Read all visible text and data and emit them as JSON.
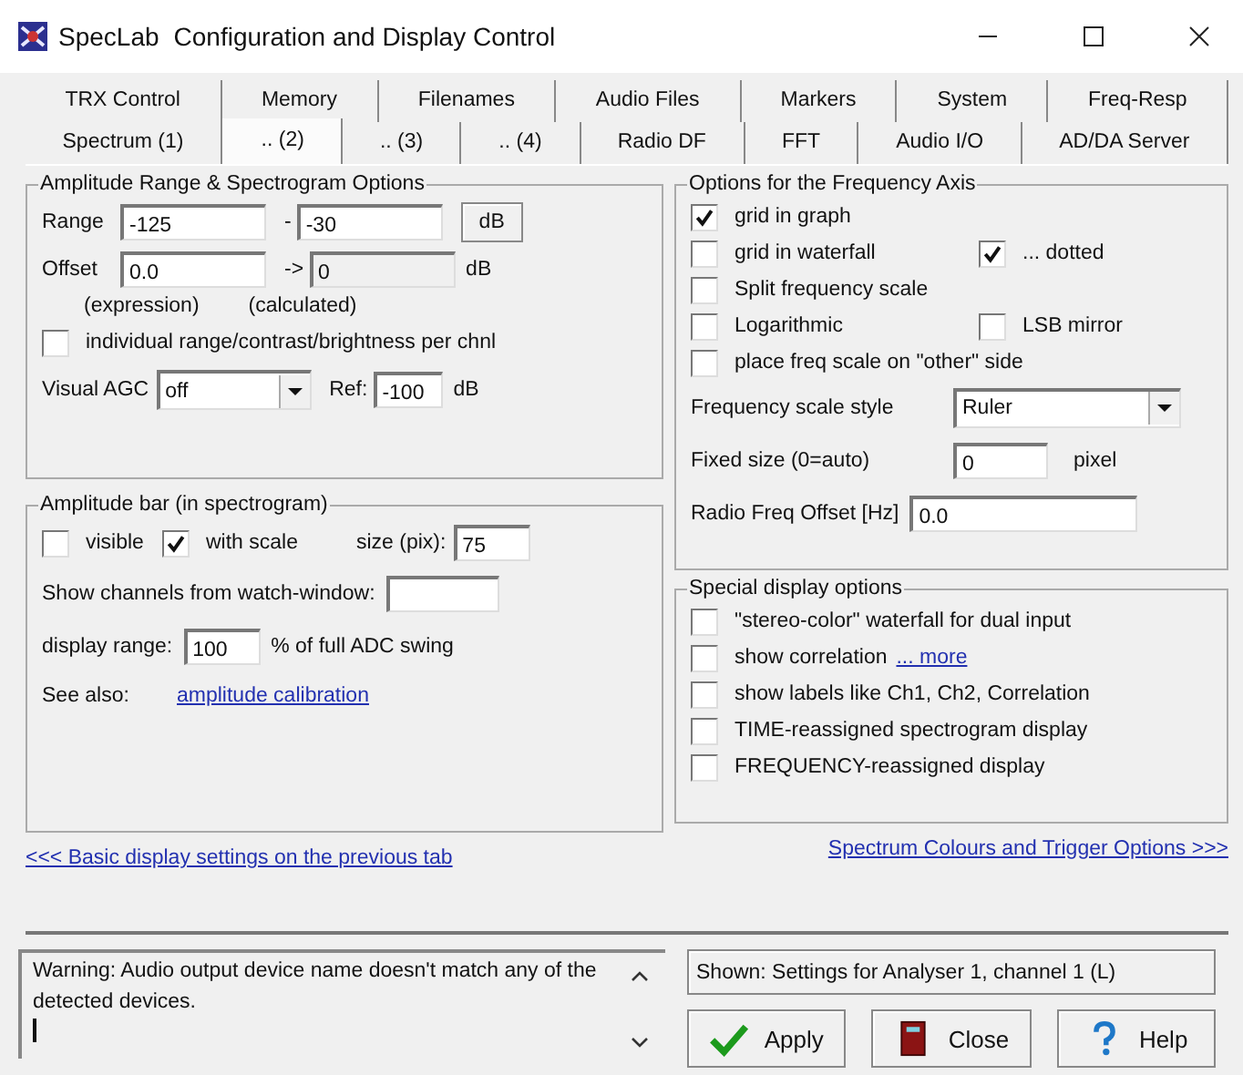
{
  "window": {
    "app_name": "SpecLab",
    "title": "Configuration and Display Control"
  },
  "tabs": [
    [
      {
        "label": "TRX Control",
        "selected": false
      },
      {
        "label": "Memory",
        "selected": false
      },
      {
        "label": "Filenames",
        "selected": false
      },
      {
        "label": "Audio Files",
        "selected": false
      },
      {
        "label": "Markers",
        "selected": false
      },
      {
        "label": "System",
        "selected": false
      },
      {
        "label": "Freq-Resp",
        "selected": false
      }
    ],
    [
      {
        "label": "Spectrum (1)",
        "selected": false
      },
      {
        "label": ".. (2)",
        "selected": true
      },
      {
        "label": ".. (3)",
        "selected": false
      },
      {
        "label": ".. (4)",
        "selected": false
      },
      {
        "label": "Radio DF",
        "selected": false
      },
      {
        "label": "FFT",
        "selected": false
      },
      {
        "label": "Audio I/O",
        "selected": false
      },
      {
        "label": "AD/DA Server",
        "selected": false
      }
    ]
  ],
  "amplitude_range": {
    "title": "Amplitude Range & Spectrogram Options",
    "range_label": "Range",
    "range_from": "-125",
    "range_sep": "-",
    "range_to": "-30",
    "range_unit": "dB",
    "offset_label": "Offset",
    "offset_value": "0.0",
    "offset_arrow": "->",
    "offset_calculated": "0",
    "offset_unit": "dB",
    "caption_expression": "(expression)",
    "caption_calculated": "(calculated)",
    "individual": {
      "label": "individual range/contrast/brightness per chnl",
      "checked": false
    },
    "agc_label": "Visual AGC",
    "agc_value": "off",
    "ref_label": "Ref:",
    "ref_value": "-100",
    "ref_unit": "dB"
  },
  "amplitude_bar": {
    "title": "Amplitude bar (in spectrogram)",
    "visible": {
      "label": "visible",
      "checked": false
    },
    "with_scale": {
      "label": "with scale",
      "checked": true
    },
    "size_label": "size (pix):",
    "size_value": "75",
    "watch_label": "Show channels from watch-window:",
    "range_label": "display range:",
    "range_value": "100",
    "range_unit": "% of full ADC swing",
    "see_also_label": "See also:",
    "see_also_link": "amplitude calibration"
  },
  "frequency_axis": {
    "title": "Options for the Frequency Axis",
    "rows": [
      [
        {
          "label": "grid in graph",
          "checked": true
        }
      ],
      [
        {
          "label": "grid in waterfall",
          "checked": false
        },
        {
          "label": "... dotted",
          "checked": true
        }
      ],
      [
        {
          "label": "Split frequency scale",
          "checked": false
        }
      ],
      [
        {
          "label": "Logarithmic",
          "checked": false
        },
        {
          "label": "LSB mirror",
          "checked": false
        }
      ],
      [
        {
          "label": "place freq scale on \"other\" side",
          "checked": false
        }
      ]
    ],
    "style_label": "Frequency scale style",
    "style_value": "Ruler",
    "fixed_label": "Fixed size (0=auto)",
    "fixed_value": "0",
    "fixed_unit": "pixel",
    "offset_label": "Radio Freq Offset [Hz]",
    "offset_value": "0.0"
  },
  "special": {
    "title": "Special display options",
    "options": [
      {
        "label": "\"stereo-color\" waterfall for dual input",
        "checked": false
      },
      {
        "label": "show correlation",
        "checked": false,
        "link": "... more"
      },
      {
        "label": "show labels like Ch1, Ch2, Correlation",
        "checked": false
      },
      {
        "label": "TIME-reassigned spectrogram display",
        "checked": false
      },
      {
        "label": "FREQUENCY-reassigned display",
        "checked": false
      }
    ]
  },
  "nav_links": {
    "previous": "<<< Basic display settings on the previous tab",
    "next": "Spectrum Colours and Trigger Options >>>"
  },
  "status": {
    "message": "Warning: Audio output device name doesn't match any of the detected devices.",
    "shown": "Shown: Settings for Analyser 1, channel 1 (L)"
  },
  "buttons": [
    {
      "label": "Apply",
      "kind": "apply"
    },
    {
      "label": "Close",
      "kind": "close"
    },
    {
      "label": "Help",
      "kind": "help"
    }
  ]
}
